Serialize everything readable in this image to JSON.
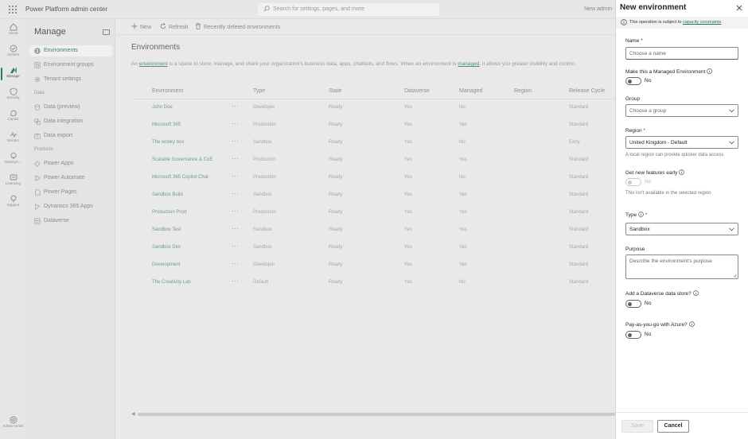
{
  "app": {
    "title": "Power Platform admin center",
    "search_placeholder": "Search for settings, pages, and more",
    "topbar_right": "New admin"
  },
  "rail": [
    {
      "label": "Home",
      "icon": "home-icon"
    },
    {
      "label": "Actions",
      "icon": "actions-icon"
    },
    {
      "label": "Manage",
      "icon": "manage-icon",
      "active": true
    },
    {
      "label": "Security",
      "icon": "shield-icon"
    },
    {
      "label": "Copilot",
      "icon": "copilot-icon"
    },
    {
      "label": "Monitor",
      "icon": "monitor-icon"
    },
    {
      "label": "Deploym...",
      "icon": "deployment-icon"
    },
    {
      "label": "Licensing",
      "icon": "licensing-icon"
    },
    {
      "label": "Support",
      "icon": "support-icon"
    },
    {
      "label": "Admin center",
      "icon": "admin-center-icon"
    }
  ],
  "nav": {
    "title": "Manage",
    "items": [
      {
        "label": "Environments",
        "icon": "globe-icon",
        "selected": true
      },
      {
        "label": "Environment groups",
        "icon": "environment-groups-icon"
      },
      {
        "label": "Tenant settings",
        "icon": "gear-icon"
      }
    ],
    "section_data": "Data",
    "data_items": [
      {
        "label": "Data (preview)",
        "icon": "data-icon"
      },
      {
        "label": "Data integration",
        "icon": "data-integration-icon"
      },
      {
        "label": "Data export",
        "icon": "data-export-icon"
      }
    ],
    "section_products": "Products",
    "product_items": [
      {
        "label": "Power Apps",
        "icon": "power-apps-icon"
      },
      {
        "label": "Power Automate",
        "icon": "power-automate-icon"
      },
      {
        "label": "Power Pages",
        "icon": "power-pages-icon"
      },
      {
        "label": "Dynamics 365 Apps",
        "icon": "dynamics-icon"
      },
      {
        "label": "Dataverse",
        "icon": "dataverse-icon"
      }
    ]
  },
  "commands": {
    "new": "New",
    "refresh": "Refresh",
    "recently_deleted": "Recently deleted environments"
  },
  "main": {
    "title": "Environments",
    "desc_prefix": "An ",
    "desc_link1": "environment",
    "desc_middle": " is a space to store, manage, and share your organization's business data, apps, chatbots, and flows. When an environment is ",
    "desc_link2": "managed",
    "desc_suffix": ", it allows you greater visibility and control."
  },
  "table": {
    "columns": [
      "Environment",
      "Type",
      "State",
      "Dataverse",
      "Managed",
      "Region",
      "Release Cycle"
    ],
    "rows": [
      [
        "John Doe",
        "Developer",
        "Ready",
        "Yes",
        "No",
        "",
        "Standard"
      ],
      [
        "Microsoft 365",
        "Production",
        "Ready",
        "Yes",
        "Yes",
        "",
        "Standard"
      ],
      [
        "The wonky box",
        "Sandbox",
        "Ready",
        "Yes",
        "No",
        "",
        "Early"
      ],
      [
        "Scalable Governance & CoE",
        "Production",
        "Ready",
        "Yes",
        "Yes",
        "",
        "Standard"
      ],
      [
        "Microsoft 365 Copilot Chat",
        "Production",
        "Ready",
        "Yes",
        "No",
        "",
        "Standard"
      ],
      [
        "Sandbox Build",
        "Sandbox",
        "Ready",
        "Yes",
        "Yes",
        "",
        "Standard"
      ],
      [
        "Production Prod",
        "Production",
        "Ready",
        "Yes",
        "Yes",
        "",
        "Standard"
      ],
      [
        "Sandbox Test",
        "Sandbox",
        "Ready",
        "Yes",
        "Yes",
        "",
        "Standard"
      ],
      [
        "Sandbox Dev",
        "Sandbox",
        "Ready",
        "Yes",
        "Yes",
        "",
        "Standard"
      ],
      [
        "Development",
        "Developer",
        "Ready",
        "Yes",
        "Yes",
        "",
        "Standard"
      ],
      [
        "The Creativity Lab",
        "Default",
        "Ready",
        "Yes",
        "No",
        "",
        "Standard"
      ]
    ]
  },
  "panel": {
    "title": "New environment",
    "notice_text": "This operation is subject to ",
    "notice_link": "capacity constraints",
    "name_label": "Name",
    "name_placeholder": "Choose a name",
    "managed_label": "Make this a Managed Environment",
    "managed_value": "No",
    "group_label": "Group",
    "group_placeholder": "Choose a group",
    "region_label": "Region",
    "region_value": "United Kingdom - Default",
    "region_hint": "A local region can provide quicker data access",
    "early_label": "Get new features early",
    "early_value": "No",
    "early_hint": "This isn't available in the selected region",
    "type_label": "Type",
    "type_value": "Sandbox",
    "purpose_label": "Purpose",
    "purpose_placeholder": "Describe the environment's purpose",
    "dataverse_label": "Add a Dataverse data store?",
    "dataverse_value": "No",
    "payg_label": "Pay-as-you-go with Azure?",
    "payg_value": "No",
    "required_mark": "*",
    "save_label": "Save",
    "cancel_label": "Cancel"
  },
  "colors": {
    "accent": "#2b7a5d",
    "link": "#2b6e56",
    "required": "#b02a2a"
  }
}
